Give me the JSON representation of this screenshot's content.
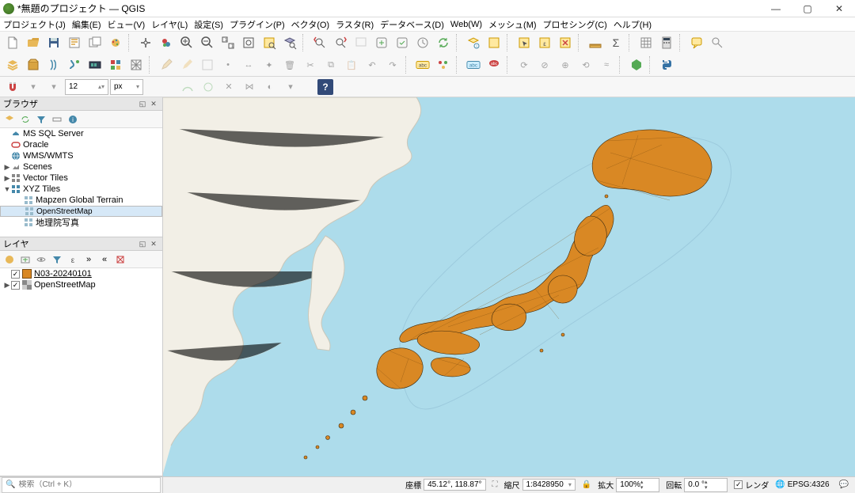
{
  "window": {
    "title": "*無題のプロジェクト — QGIS"
  },
  "menu": [
    "プロジェクト(J)",
    "編集(E)",
    "ビュー(V)",
    "レイヤ(L)",
    "設定(S)",
    "プラグイン(P)",
    "ベクタ(O)",
    "ラスタ(R)",
    "データベース(D)",
    "Web(W)",
    "メッシュ(M)",
    "プロセシング(C)",
    "ヘルプ(H)"
  ],
  "digitize": {
    "size_value": "12",
    "size_unit": "px"
  },
  "browser": {
    "title": "ブラウザ",
    "items": [
      {
        "indent": 0,
        "expander": "",
        "icon": "mssql",
        "label": "MS SQL Server"
      },
      {
        "indent": 0,
        "expander": "",
        "icon": "oracle",
        "label": "Oracle"
      },
      {
        "indent": 0,
        "expander": "",
        "icon": "wms",
        "label": "WMS/WMTS"
      },
      {
        "indent": 0,
        "expander": "▶",
        "icon": "scenes",
        "label": "Scenes"
      },
      {
        "indent": 0,
        "expander": "▶",
        "icon": "vt",
        "label": "Vector Tiles"
      },
      {
        "indent": 0,
        "expander": "▼",
        "icon": "xyz",
        "label": "XYZ Tiles"
      },
      {
        "indent": 1,
        "expander": "",
        "icon": "xyzi",
        "label": "Mapzen Global Terrain"
      },
      {
        "indent": 1,
        "expander": "",
        "icon": "xyzi",
        "label": "OpenStreetMap",
        "selected": true
      },
      {
        "indent": 1,
        "expander": "",
        "icon": "xyzi",
        "label": "地理院写真"
      }
    ]
  },
  "layers": {
    "title": "レイヤ",
    "items": [
      {
        "expander": "",
        "checked": true,
        "swatch": "#d98824",
        "label": "N03-20240101",
        "underline": true
      },
      {
        "expander": "▶",
        "checked": true,
        "swatch": "osm",
        "label": "OpenStreetMap"
      }
    ]
  },
  "search": {
    "placeholder": "検索（Ctrl + K）"
  },
  "status": {
    "coord_label": "座標",
    "coord_value": "45.12°, 118.87°",
    "scale_label": "縮尺",
    "scale_value": "1:8428950",
    "magnifier_label": "拡大",
    "magnifier_value": "100%",
    "rotation_label": "回転",
    "rotation_value": "0.0 °",
    "render_label": "レンダ",
    "crs": "EPSG:4326"
  },
  "chart_data": {
    "type": "map",
    "title": "Japan administrative boundaries (N03-20240101) over OpenStreetMap",
    "layers": [
      {
        "name": "N03-20240101",
        "style_fill": "#d98824",
        "style_stroke": "#000000",
        "type": "polygon",
        "description": "Japanese municipal boundaries shown filled orange"
      },
      {
        "name": "OpenStreetMap",
        "type": "basemap"
      }
    ],
    "approx_extent_deg": {
      "west": 108,
      "east": 151,
      "south": 23,
      "north": 49
    },
    "scale_denominator": 8428950,
    "cursor_coord_deg": {
      "lat": 45.12,
      "lon": 118.87
    },
    "crs": "EPSG:4326"
  }
}
